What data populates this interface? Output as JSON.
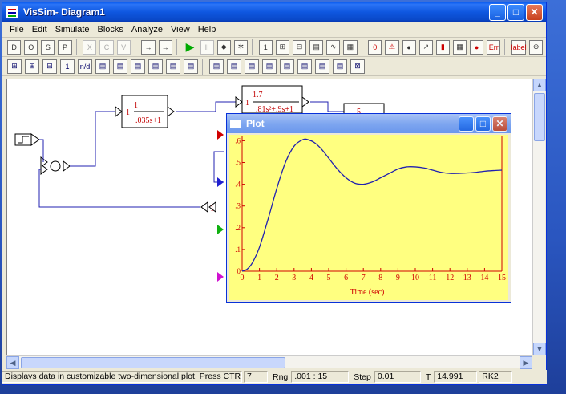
{
  "window": {
    "title": "VisSim- Diagram1"
  },
  "menu": [
    "File",
    "Edit",
    "Simulate",
    "Blocks",
    "Analyze",
    "View",
    "Help"
  ],
  "toolbar1": [
    "D",
    "O",
    "S",
    "P",
    "X",
    "C",
    "V",
    "→",
    "→",
    "▶",
    "II",
    "◆",
    "✲",
    "1",
    "⊞",
    "⊟",
    "▤",
    "∿",
    "▦",
    "0",
    "⚠",
    "●",
    "↗",
    "▮",
    "▦",
    "●",
    "Err",
    "label",
    "⊕"
  ],
  "toolbar2": [
    "⊞",
    "⊞",
    "⊟",
    "1",
    "n/d",
    "▤",
    "▤",
    "▤",
    "▤",
    "▤",
    "▤",
    "▤",
    "▤",
    "▤",
    "▤",
    "▤",
    "▤",
    "▤",
    "▤",
    "⊠"
  ],
  "blocks": {
    "tf1_num": "1",
    "tf1_gain": "1",
    "tf1_den": ".035s+1",
    "tf2_num": "1.7",
    "tf2_gain": "1",
    "tf2_den": ".81s²+.9s+1",
    "tf3_num": "5",
    "feedback_gain": "1"
  },
  "plot": {
    "title": "Plot",
    "xlabel": "Time (sec)"
  },
  "chart_data": {
    "type": "line",
    "xlabel": "Time (sec)",
    "xlim": [
      0,
      15
    ],
    "ylim": [
      0,
      0.62
    ],
    "xticks": [
      0,
      1,
      2,
      3,
      4,
      5,
      6,
      7,
      8,
      9,
      10,
      11,
      12,
      13,
      14,
      15
    ],
    "yticks": [
      0,
      0.1,
      0.2,
      0.3,
      0.4,
      0.5,
      0.6
    ],
    "ytick_labels": [
      "0",
      ".1",
      ".2",
      ".3",
      ".4",
      ".5",
      ".6"
    ],
    "series": [
      {
        "x": [
          0,
          0.3,
          0.6,
          1,
          1.5,
          2,
          2.5,
          3,
          3.5,
          3.8,
          4.2,
          4.6,
          5,
          5.5,
          6,
          6.5,
          7,
          7.5,
          8,
          8.5,
          9,
          9.5,
          10,
          10.5,
          11,
          11.5,
          12,
          12.5,
          13,
          13.5,
          14,
          14.5,
          15
        ],
        "y": [
          0,
          0.01,
          0.04,
          0.11,
          0.24,
          0.38,
          0.5,
          0.575,
          0.605,
          0.605,
          0.59,
          0.56,
          0.52,
          0.47,
          0.43,
          0.405,
          0.4,
          0.41,
          0.43,
          0.45,
          0.47,
          0.48,
          0.48,
          0.475,
          0.465,
          0.455,
          0.45,
          0.45,
          0.452,
          0.455,
          0.46,
          0.463,
          0.465
        ],
        "color": "#2020b0"
      }
    ],
    "axis_color": "#d00000",
    "background": "#ffff80"
  },
  "status": {
    "message": "Displays data in customizable two-dimensional plot. Press CTRL+ Blks",
    "blocks_count": "7",
    "rng_label": "Rng",
    "rng_value": ".001 : 15",
    "step_label": "Step",
    "step_value": "0.01",
    "t_label": "T",
    "t_value": "14.991",
    "method": "RK2"
  }
}
